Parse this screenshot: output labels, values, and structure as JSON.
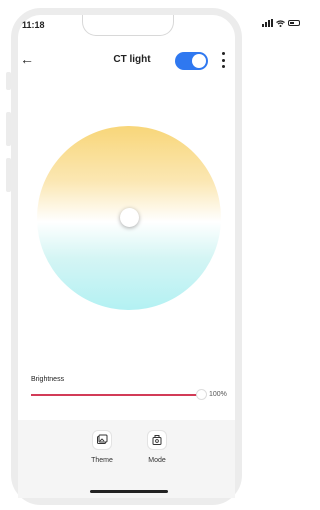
{
  "status_bar": {
    "time": "11:18"
  },
  "header": {
    "title": "CT light",
    "power_on": true
  },
  "color_temperature": {
    "gradient_warm": "#f8d679",
    "gradient_cool": "#b3f1f3"
  },
  "brightness": {
    "label": "Brightness",
    "value_text": "100%",
    "value": 1.0,
    "accent": "#d23b57"
  },
  "bottom_tabs": [
    {
      "label": "Theme",
      "icon": "theme-icon"
    },
    {
      "label": "Mode",
      "icon": "mode-icon"
    }
  ],
  "colors": {
    "toggle_on": "#2f78f0"
  }
}
